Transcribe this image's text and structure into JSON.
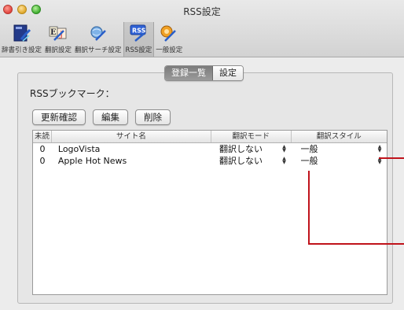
{
  "window": {
    "title": "RSS設定"
  },
  "toolbar": {
    "items": [
      {
        "label": "辞書引き設定",
        "icon": "dictionary-book-icon",
        "active": false
      },
      {
        "label": "翻訳設定",
        "icon": "translate-ej-icon",
        "active": false
      },
      {
        "label": "翻訳サーチ設定",
        "icon": "translate-search-icon",
        "active": false
      },
      {
        "label": "RSS設定",
        "icon": "rss-icon",
        "active": true
      },
      {
        "label": "一般設定",
        "icon": "general-settings-icon",
        "active": false
      }
    ]
  },
  "segments": {
    "list_label": "登録一覧",
    "settings_label": "設定",
    "selected": "list"
  },
  "bookmarks": {
    "label": "RSSブックマーク："
  },
  "buttons": {
    "update_label": "更新確認",
    "edit_label": "編集",
    "delete_label": "削除"
  },
  "table": {
    "headers": {
      "unread": "未読",
      "site": "サイト名",
      "mode": "翻訳モード",
      "style": "翻訳スタイル"
    },
    "rows": [
      {
        "unread": "0",
        "site": "LogoVista",
        "mode": "翻訳しない",
        "style": "一般"
      },
      {
        "unread": "0",
        "site": "Apple Hot News",
        "mode": "翻訳しない",
        "style": "一般"
      }
    ]
  },
  "colors": {
    "callout": "#c0131b",
    "window_bg": "#ececec",
    "selected_segment": "#8a8a8a"
  }
}
